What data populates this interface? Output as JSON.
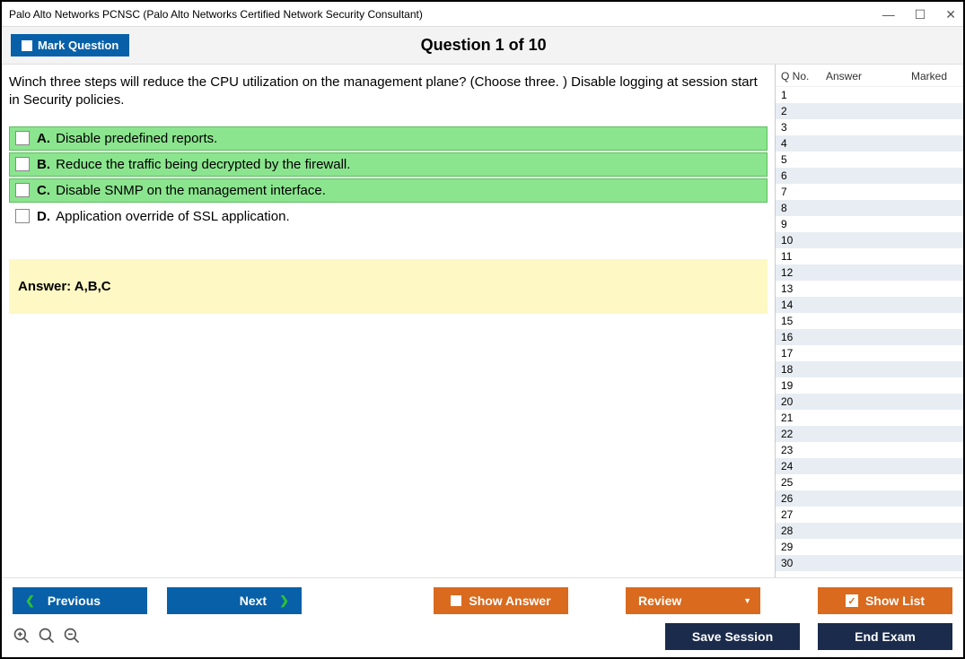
{
  "window": {
    "title": "Palo Alto Networks PCNSC (Palo Alto Networks Certified Network Security Consultant)"
  },
  "header": {
    "mark_label": "Mark Question",
    "question_title": "Question 1 of 10"
  },
  "question": {
    "stem": "Winch three steps will reduce the CPU utilization on the management plane? (Choose three. ) Disable logging at session start in Security policies.",
    "options": [
      {
        "letter": "A.",
        "text": "Disable predefined reports.",
        "correct": true
      },
      {
        "letter": "B.",
        "text": "Reduce the traffic being decrypted by the firewall.",
        "correct": true
      },
      {
        "letter": "C.",
        "text": "Disable SNMP on the management interface.",
        "correct": true
      },
      {
        "letter": "D.",
        "text": "Application override of SSL application.",
        "correct": false
      }
    ],
    "answer_line": "Answer: A,B,C"
  },
  "side": {
    "head": {
      "qno": "Q No.",
      "answer": "Answer",
      "marked": "Marked"
    },
    "count": 30
  },
  "footer": {
    "previous": "Previous",
    "next": "Next",
    "show_answer": "Show Answer",
    "review": "Review",
    "show_list": "Show List",
    "save_session": "Save Session",
    "end_exam": "End Exam"
  }
}
